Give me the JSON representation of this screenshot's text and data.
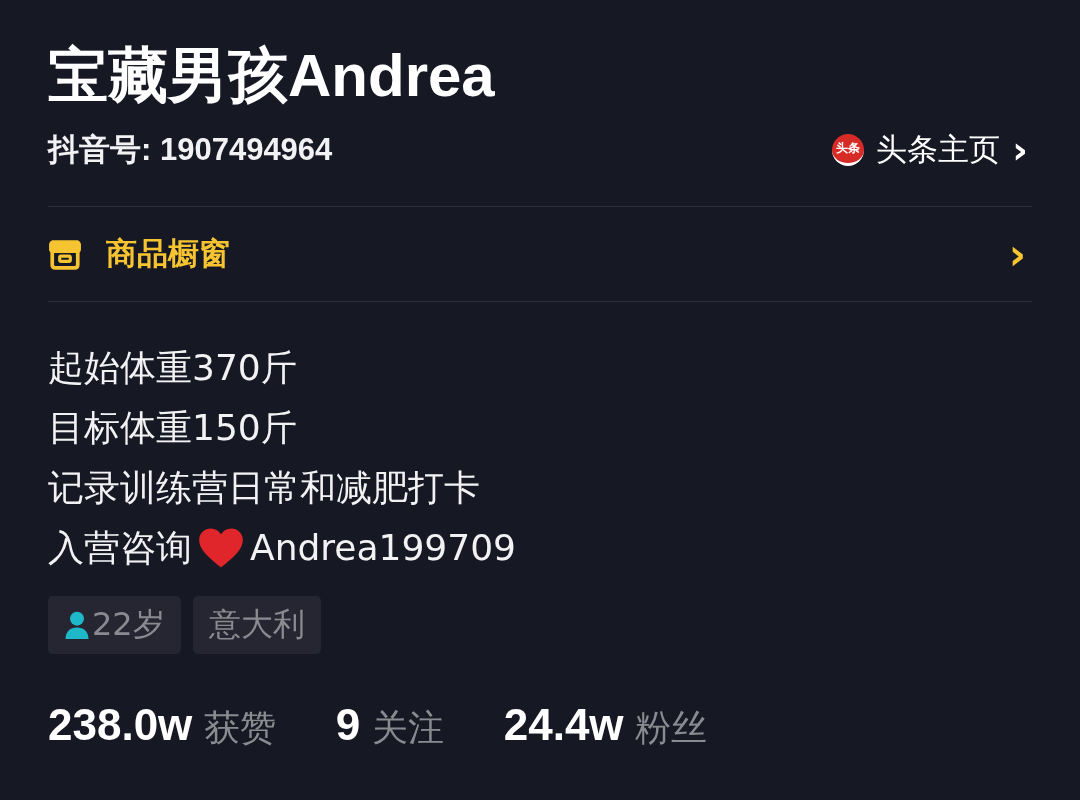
{
  "profile": {
    "name": "宝藏男孩Andrea",
    "id_label": "抖音号: 1907494964",
    "toutiao": {
      "badge": "头条",
      "label": "头条主页",
      "chevron": "›"
    }
  },
  "shop": {
    "label": "商品橱窗",
    "chevron": "›"
  },
  "bio": [
    {
      "text": "起始体重370斤"
    },
    {
      "text": "目标体重150斤"
    },
    {
      "text": "记录训练营日常和减肥打卡"
    },
    {
      "kind": "with_heart",
      "text": "入营咨询",
      "text_after": "Andrea199709"
    }
  ],
  "tags": [
    {
      "kind": "age",
      "label": "22岁"
    },
    {
      "kind": "place",
      "label": "意大利"
    }
  ],
  "stats": [
    "**238.0w** 获赞",
    "**9** 关注",
    "**24.4w** 粉丝"
  ]
}
